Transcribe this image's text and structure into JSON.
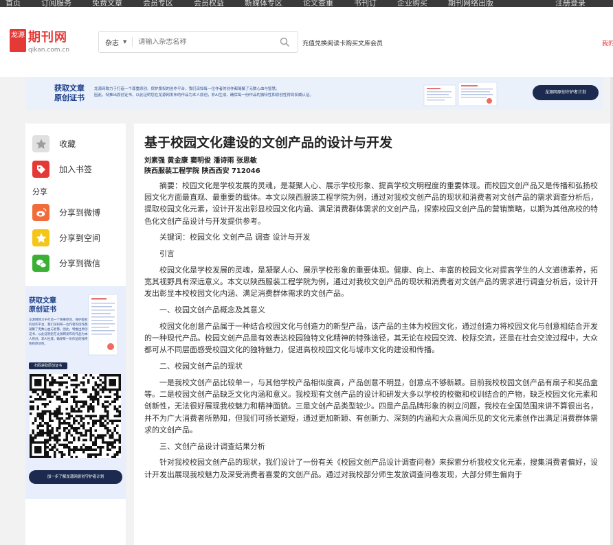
{
  "topbar": {
    "items": [
      "首页",
      "订阅服务",
      "免费文章",
      "会员专区",
      "会员权益",
      "新媒体专区",
      "论文查重",
      "书刊订",
      "企业购买",
      "期刊网络出版"
    ],
    "right": "注册登录"
  },
  "header": {
    "logo_mark": "龙源",
    "logo_text": "期刊网",
    "logo_domain": "qikan.com.cn",
    "search_scope": "杂志",
    "search_placeholder": "请输入杂志名称",
    "member_link": "充值兑换阅读卡购买文库会员",
    "right_cut": "我的"
  },
  "banner": {
    "title_line1": "获取文章",
    "title_line2": "原创证书",
    "desc_line1": "龙源网致力于打造一个尊重原创、保护版权的创作平台，我们深知每一位作者的创作都凝聚了无数心血与智慧。",
    "desc_line2": "因此，特推出原创证书，以此证明您在龙源网发布的作品为本人原创，非AI生成，确保每一份作品的独特性和原创性得到权威认证。",
    "cta": "龙源网原创守护者计划"
  },
  "sidebar": {
    "favorite": "收藏",
    "bookmark": "加入书签",
    "share_label": "分享",
    "share_weibo": "分享到微博",
    "share_qzone": "分享到空间",
    "share_wechat": "分享到微信",
    "promo": {
      "title_line1": "获取文章",
      "title_line2": "原创证书",
      "text": "龙源网致力于打造一个尊重原创、保护版权的创作平台，我们深知每一位作者的创作都凝聚了无数心血与智慧。因此，特推出原创证书，以此证明您在龙源网发布的作品为本人原创，非AI生成，确保每一份作品的独特性和原创性。",
      "tag": "扫码获取原创证书",
      "cta": "加一步了解龙源网原创守护者计划"
    }
  },
  "article": {
    "title": "基于校园文化建设的文创产品的设计与开发",
    "authors": "刘素强 黄金康 窦明俊 潘诗雨 张思敏",
    "affiliation": "陕西服装工程学院 陕西西安 712046",
    "paragraphs": [
      "摘要：校园文化是学校发展的灵魂，是凝聚人心、展示学校形象、提高学校文明程度的重要体现。而校园文创产品又是传播和弘扬校园文化方面最直观、最重要的载体。本文以陕西服装工程学院为例，通过对我校文创产品的现状和消费者对文创产品的需求调查分析后，提取校园文化元素，设计开发出彰显校园文化内涵、满足消费群体需求的文创产品，探索校园文创产品的营销策略，以期为其他高校的特色化文创产品设计与开发提供参考。",
      "关键词：校园文化 文创产品 调查 设计与开发",
      "引言",
      "校园文化是学校发展的灵魂，是凝聚人心、展示学校形象的重要体现。健康、向上、丰富的校园文化对提高学生的人文道德素养，拓宽其视野具有深远意义。本文以陕西服装工程学院为例，通过对我校文创产品的现状和消费者对文创产品的需求进行调查分析后，设计开发出彰显本校校园文化内涵、满足消费群体需求的文创产品。",
      "一、校园文创产品概念及其意义",
      "校园文化创意产品属于一种结合校园文化与创造力的新型产品，该产品的主体为校园文化，通过创造力将校园文化与创意相结合开发的一种现代产品。校园文创产品是有效表达校园独特文化精神的特殊途径，其无论在校园交流、校际交流，还是在社会交流过程中，大众都可从不同层面感受校园文化的独特魅力，促进高校校园文化与城市文化的建设和传播。",
      "二、校园文创产品的现状",
      "一是我校文创产品比较单一，与其他学校产品相似度高，产品创意不明显，创意点不够新颖。目前我校校园文创产品有扇子和奖品盒等。二是校园文创产品缺乏文化内涵和意义。我校现有文创产品的设计和研发大多以学校的校徽和校训结合的产物，缺乏校园文化元素和创新性，无法很好展现我校魅力和精神面貌。三是文创产品类型较少。四是产品品牌形象的树立问题，我校在全国范围来讲不算很出名，并不为广大消费者所熟知，但我们可扬长避短，通过更加新颖、有创新力、深刻的内涵和大众喜闻乐见的文化元素创作出满足消费群体需求的文创产品。",
      "三、文创产品设计调查结果分析",
      "针对我校校园文创产品的现状，我们设计了一份有关《校园文创产品设计调查问卷》来探索分析我校文化元素，搜集消费者偏好，设计开发出展现我校魅力及深受消费者喜爱的文创产品。通过对我校部分师生发放调查问卷发现，大部分师生偏向于"
    ]
  }
}
